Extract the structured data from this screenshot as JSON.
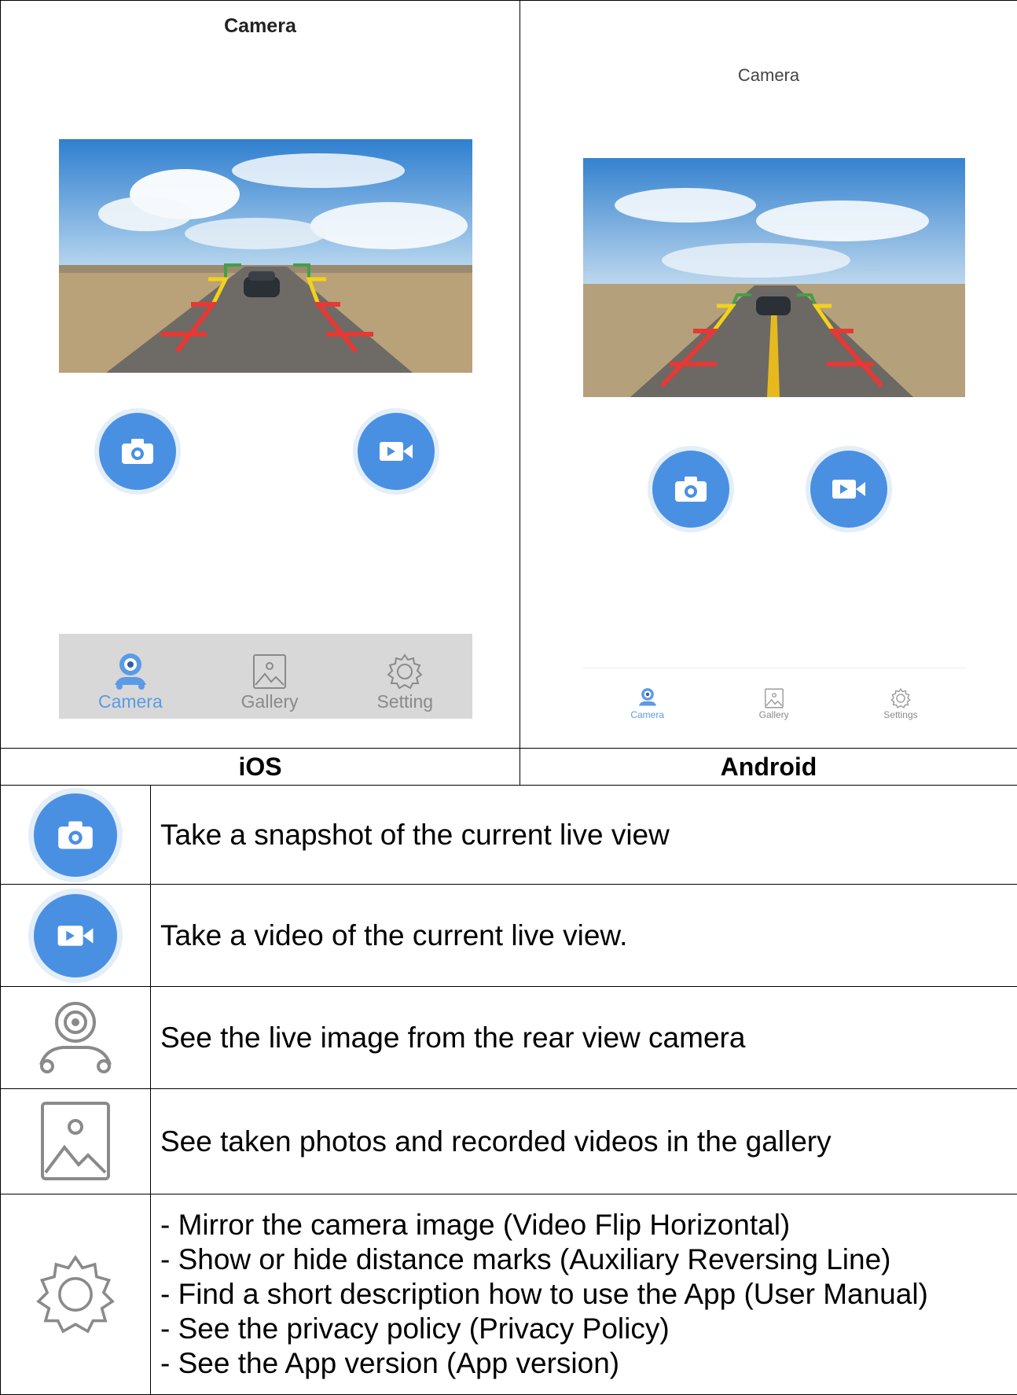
{
  "screens": {
    "ios": {
      "title": "Camera",
      "tabs": [
        {
          "label": "Camera",
          "icon": "camera-car-icon",
          "active": true
        },
        {
          "label": "Gallery",
          "icon": "gallery-icon",
          "active": false
        },
        {
          "label": "Setting",
          "icon": "gear-icon",
          "active": false
        }
      ],
      "caption": "iOS"
    },
    "android": {
      "title": "Camera",
      "tabs": [
        {
          "label": "Camera",
          "icon": "camera-car-icon",
          "active": true
        },
        {
          "label": "Gallery",
          "icon": "gallery-icon",
          "active": false
        },
        {
          "label": "Settings",
          "icon": "gear-icon",
          "active": false
        }
      ],
      "caption": "Android"
    }
  },
  "legend": [
    {
      "icon": "snapshot-button-icon",
      "text": "Take a snapshot of the current live view"
    },
    {
      "icon": "video-button-icon",
      "text": "Take a video of the current live view."
    },
    {
      "icon": "camera-car-icon",
      "text": "See the live image from the rear view camera"
    },
    {
      "icon": "gallery-icon",
      "text": "See taken photos and recorded videos in the gallery"
    },
    {
      "icon": "gear-icon",
      "lines": [
        "- Mirror the camera image (Video Flip Horizontal)",
        "- Show or hide distance marks (Auxiliary Reversing Line)",
        "- Find a short description how to use the App (User Manual)",
        "- See the privacy policy (Privacy Policy)",
        "- See the App version (App version)"
      ]
    }
  ],
  "colors": {
    "accent": "#4a90e2",
    "accent_light": "#e3eef9",
    "tab_active": "#5b9be6",
    "tab_inactive": "#8a8a8a",
    "guide_red": "#e53935",
    "guide_yellow": "#f2d21a",
    "guide_green": "#43a047"
  }
}
